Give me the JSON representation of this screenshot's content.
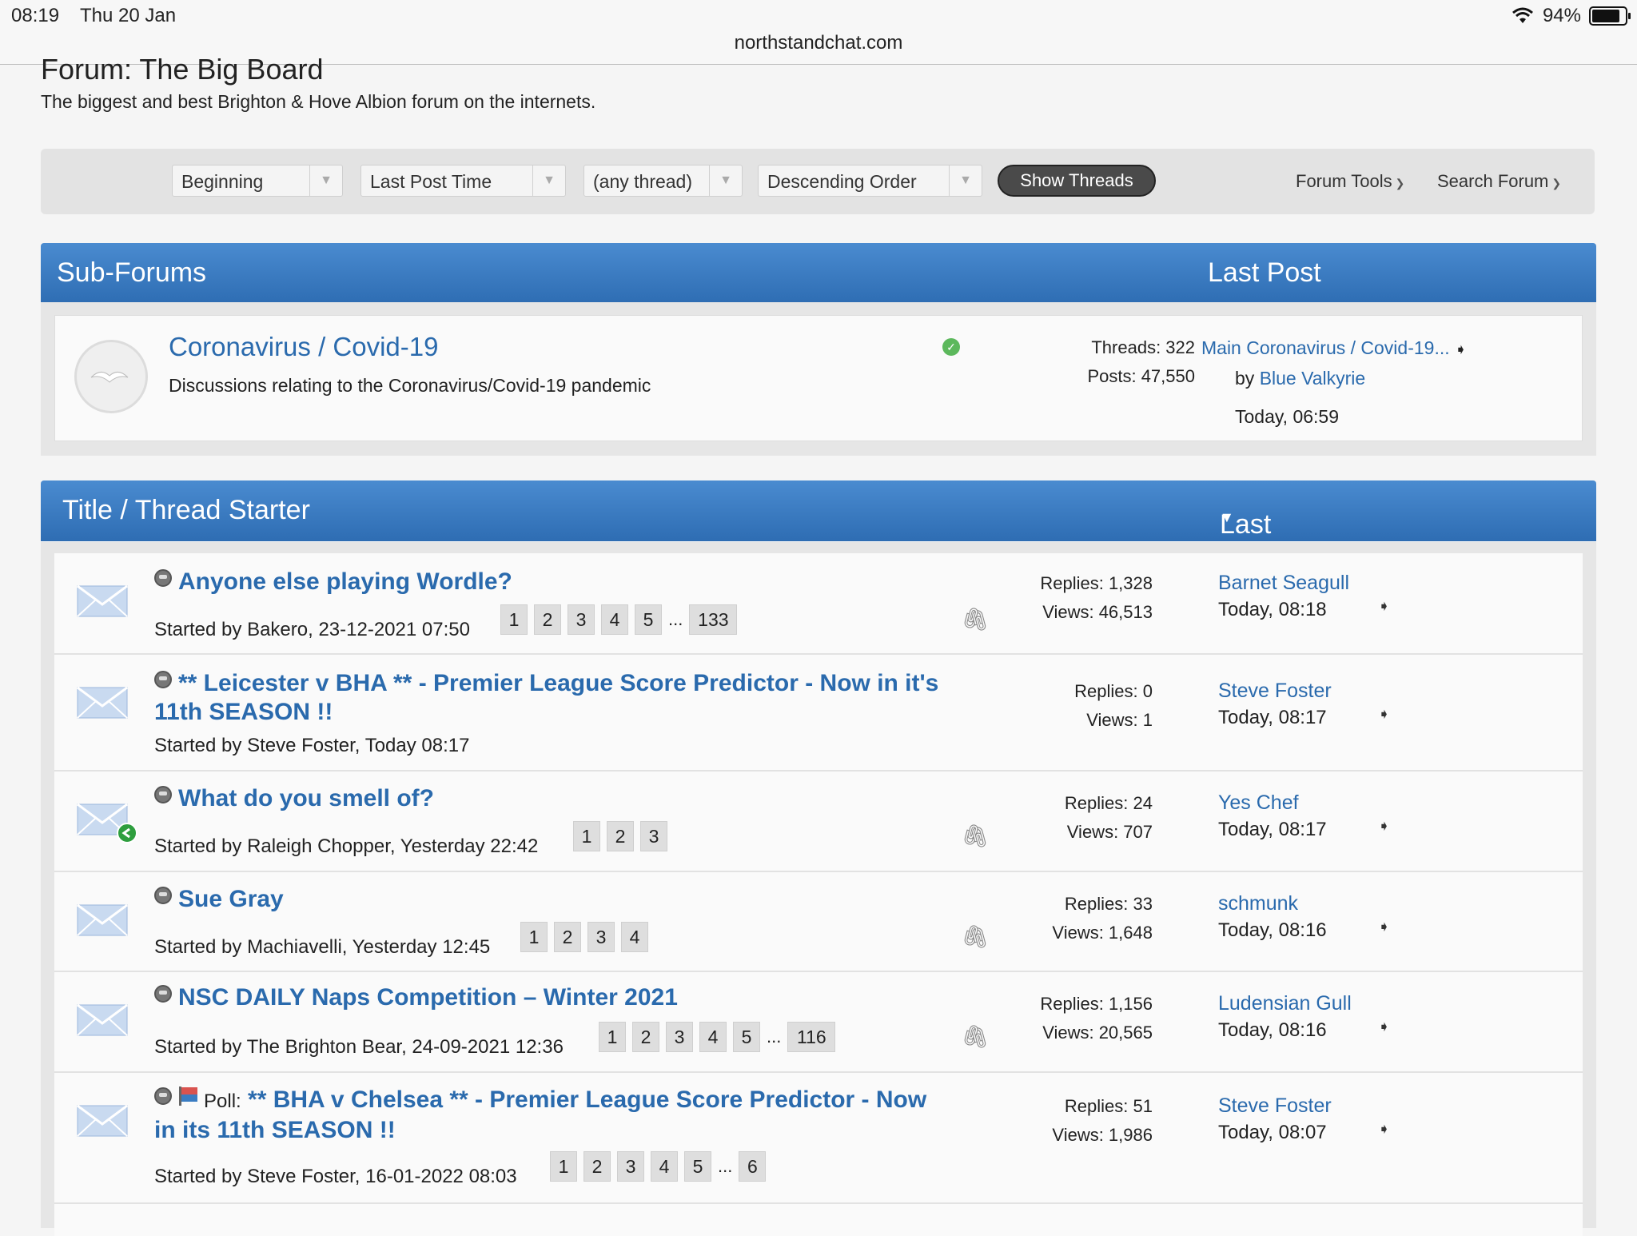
{
  "statusbar": {
    "time": "08:19",
    "date": "Thu 20 Jan",
    "url": "northstandchat.com",
    "battery": "94%"
  },
  "forum": {
    "title": "Forum: The Big Board",
    "description": "The biggest and best Brighton & Hove Albion forum on the internets."
  },
  "toolbar": {
    "from_select": "Beginning",
    "sort_select": "Last Post Time",
    "prefix_select": "(any thread)",
    "order_select": "Descending Order",
    "show_button": "Show Threads",
    "forum_tools": "Forum Tools",
    "search_forum": "Search Forum"
  },
  "subforums": {
    "header_left": "Sub-Forums",
    "header_right": "Last Post",
    "items": [
      {
        "title": "Coronavirus / Covid-19",
        "description": "Discussions relating to the Coronavirus/Covid-19 pandemic",
        "threads": "Threads: 322",
        "posts": "Posts: 47,550",
        "last_thread": "Main Coronavirus / Covid-19...",
        "by_label": "by",
        "last_user": "Blue Valkyrie",
        "last_time": "Today, 06:59"
      }
    ]
  },
  "threads": {
    "header_left": "Title / Thread Starter",
    "header_right": "Last Post By",
    "items": [
      {
        "prefix": "",
        "title1": "Anyone else playing Wordle?",
        "title2": "",
        "starter": "Started by Bakero, 23-12-2021 07:50",
        "pages": [
          "1",
          "2",
          "3",
          "4",
          "5"
        ],
        "ellipsis": "...",
        "last_page": "133",
        "replies": "Replies: 1,328",
        "views": "Views: 46,513",
        "last_by": "Barnet Seagull",
        "last_time": "Today, 08:18"
      },
      {
        "prefix": "",
        "title1": "** Leicester v BHA ** - Premier League Score Predictor - Now in it's",
        "title2": "11th SEASON !!",
        "starter": "Started by Steve Foster, Today 08:17",
        "pages": [],
        "ellipsis": "",
        "last_page": "",
        "replies": "Replies: 0",
        "views": "Views: 1",
        "last_by": "Steve Foster",
        "last_time": "Today, 08:17"
      },
      {
        "prefix": "",
        "title1": "What do you smell of?",
        "title2": "",
        "starter": "Started by Raleigh Chopper, Yesterday 22:42",
        "pages": [
          "1",
          "2",
          "3"
        ],
        "ellipsis": "",
        "last_page": "",
        "replies": "Replies: 24",
        "views": "Views: 707",
        "last_by": "Yes Chef",
        "last_time": "Today, 08:17"
      },
      {
        "prefix": "",
        "title1": "Sue Gray",
        "title2": "",
        "starter": "Started by Machiavelli, Yesterday 12:45",
        "pages": [
          "1",
          "2",
          "3",
          "4"
        ],
        "ellipsis": "",
        "last_page": "",
        "replies": "Replies: 33",
        "views": "Views: 1,648",
        "last_by": "schmunk",
        "last_time": "Today, 08:16"
      },
      {
        "prefix": "",
        "title1": "NSC DAILY Naps Competition – Winter 2021",
        "title2": "",
        "starter": "Started by The Brighton Bear, 24-09-2021 12:36",
        "pages": [
          "1",
          "2",
          "3",
          "4",
          "5"
        ],
        "ellipsis": "...",
        "last_page": "116",
        "replies": "Replies: 1,156",
        "views": "Views: 20,565",
        "last_by": "Ludensian Gull",
        "last_time": "Today, 08:16"
      },
      {
        "prefix": "Poll:",
        "title1": "** BHA v Chelsea ** - Premier League Score Predictor - Now",
        "title2": "in its 11th SEASON !!",
        "starter": "Started by Steve Foster, 16-01-2022 08:03",
        "pages": [
          "1",
          "2",
          "3",
          "4",
          "5"
        ],
        "ellipsis": "...",
        "last_page": "6",
        "replies": "Replies: 51",
        "views": "Views: 1,986",
        "last_by": "Steve Foster",
        "last_time": "Today, 08:07"
      }
    ]
  },
  "colors": {
    "accent": "#2a6aad",
    "header_blue": "#3a7cc2",
    "new_post_green": "#5cb85c"
  }
}
